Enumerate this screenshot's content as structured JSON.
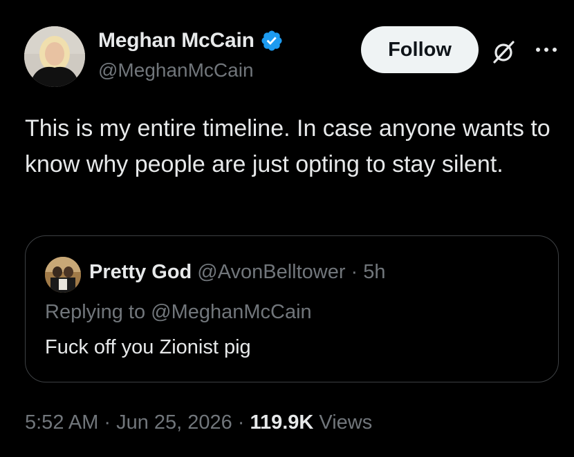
{
  "tweet": {
    "author": {
      "display_name": "Meghan McCain",
      "handle": "@MeghanMcCain",
      "verified": true
    },
    "follow_label": "Follow",
    "text": "This is my entire timeline. In case anyone wants to know why people are just opting to stay silent.",
    "quoted_tweet": {
      "display_name": "Pretty God",
      "handle": "@AvonBelltower",
      "separator": "·",
      "age": "5h",
      "replying_to": "Replying to @MeghanMcCain",
      "text": "Fuck off you Zionist pig"
    },
    "meta": {
      "time": "5:52 AM",
      "separator1": "·",
      "date": "Jun 25, 2026",
      "separator2": "·",
      "views_count": "119.9K",
      "views_label": "Views"
    }
  },
  "icons": {
    "verified": "verified-badge-icon",
    "grok": "grok-icon",
    "more": "more-options-icon"
  },
  "colors": {
    "background": "#000000",
    "text_primary": "#e7e9ea",
    "text_secondary": "#71767b",
    "verified_blue": "#1d9bf0",
    "follow_button_bg": "#eff3f4",
    "border": "#3e4144"
  }
}
